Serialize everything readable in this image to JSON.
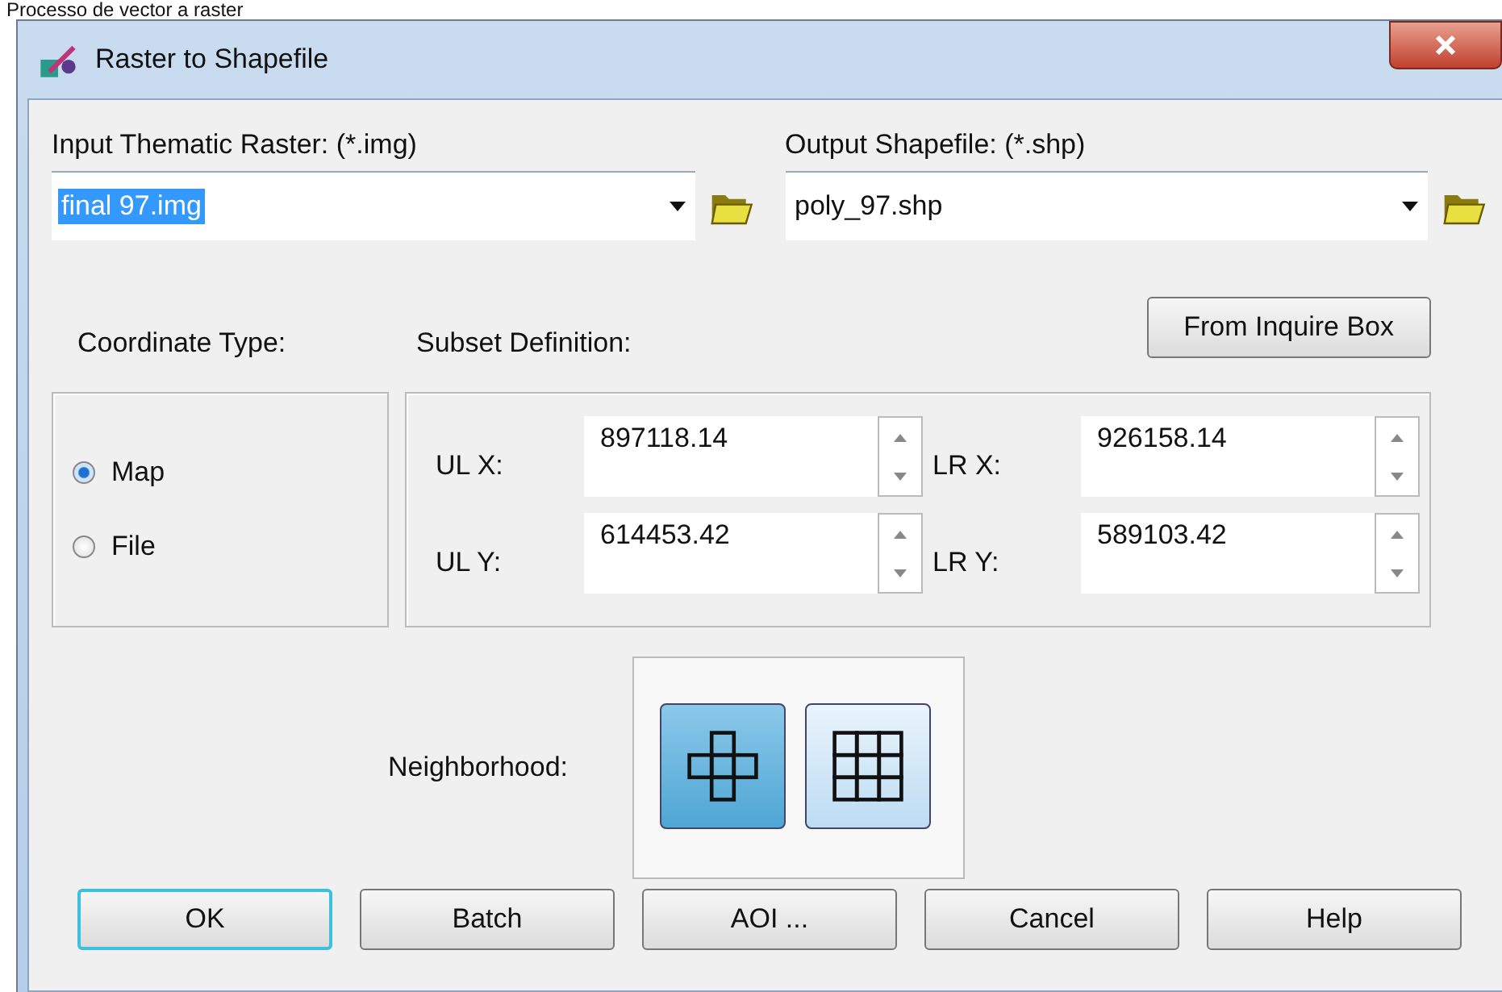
{
  "caption": "Processo de vector a raster",
  "window": {
    "title": "Raster to Shapefile"
  },
  "input": {
    "label": "Input Thematic Raster: (*.img)",
    "value": "final 97.img",
    "value_selected": true
  },
  "output": {
    "label": "Output Shapefile: (*.shp)",
    "value": "poly_97.shp",
    "value_selected": false
  },
  "from_inquire_button": "From Inquire Box",
  "coordinate_type": {
    "label": "Coordinate Type:",
    "options": [
      {
        "label": "Map",
        "selected": true
      },
      {
        "label": "File",
        "selected": false
      }
    ]
  },
  "subset": {
    "label": "Subset Definition:",
    "fields": [
      {
        "label": "UL X:",
        "value": "897118.14"
      },
      {
        "label": "LR X:",
        "value": "926158.14"
      },
      {
        "label": "UL Y:",
        "value": "614453.42"
      },
      {
        "label": "LR Y:",
        "value": "589103.42"
      }
    ]
  },
  "neighborhood": {
    "label": "Neighborhood:",
    "options": [
      {
        "kind": "four",
        "selected": true
      },
      {
        "kind": "eight",
        "selected": false
      }
    ]
  },
  "buttons": [
    {
      "label": "OK",
      "focused": true
    },
    {
      "label": "Batch",
      "focused": false
    },
    {
      "label": "AOI ...",
      "focused": false
    },
    {
      "label": "Cancel",
      "focused": false
    },
    {
      "label": "Help",
      "focused": false
    }
  ]
}
